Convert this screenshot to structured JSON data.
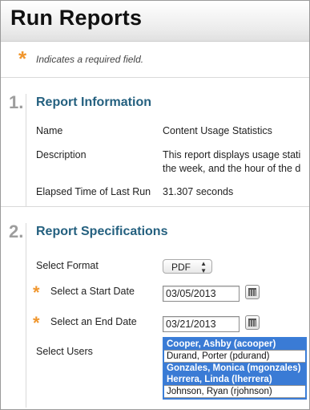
{
  "page": {
    "title": "Run Reports"
  },
  "required_note": {
    "star": "*",
    "text": "Indicates a required field."
  },
  "section1": {
    "number": "1.",
    "title": "Report Information",
    "rows": [
      {
        "label": "Name",
        "value": "Content Usage Statistics"
      },
      {
        "label": "Description",
        "value_line1": "This report displays usage stati",
        "value_line2": "the week, and the hour of the d"
      },
      {
        "label": "Elapsed Time of Last Run",
        "value": "31.307 seconds"
      }
    ]
  },
  "section2": {
    "number": "2.",
    "title": "Report Specifications",
    "format": {
      "label": "Select Format",
      "selected": "PDF"
    },
    "start_date": {
      "label": "Select a Start Date",
      "value": "03/05/2013"
    },
    "end_date": {
      "label": "Select an End Date",
      "value": "03/21/2013"
    },
    "users": {
      "label": "Select Users",
      "options": [
        {
          "text": "Cooper, Ashby (acooper)",
          "selected": true
        },
        {
          "text": "Durand, Porter (pdurand)",
          "selected": false
        },
        {
          "text": "Gonzales, Monica (mgonzales)",
          "selected": true
        },
        {
          "text": "Herrera, Linda (lherrera)",
          "selected": true
        },
        {
          "text": "Johnson, Ryan (rjohnson)",
          "selected": false
        }
      ]
    }
  },
  "colors": {
    "accent_star": "#f0962d",
    "section_title": "#24607f",
    "selection": "#3a7bd5"
  }
}
